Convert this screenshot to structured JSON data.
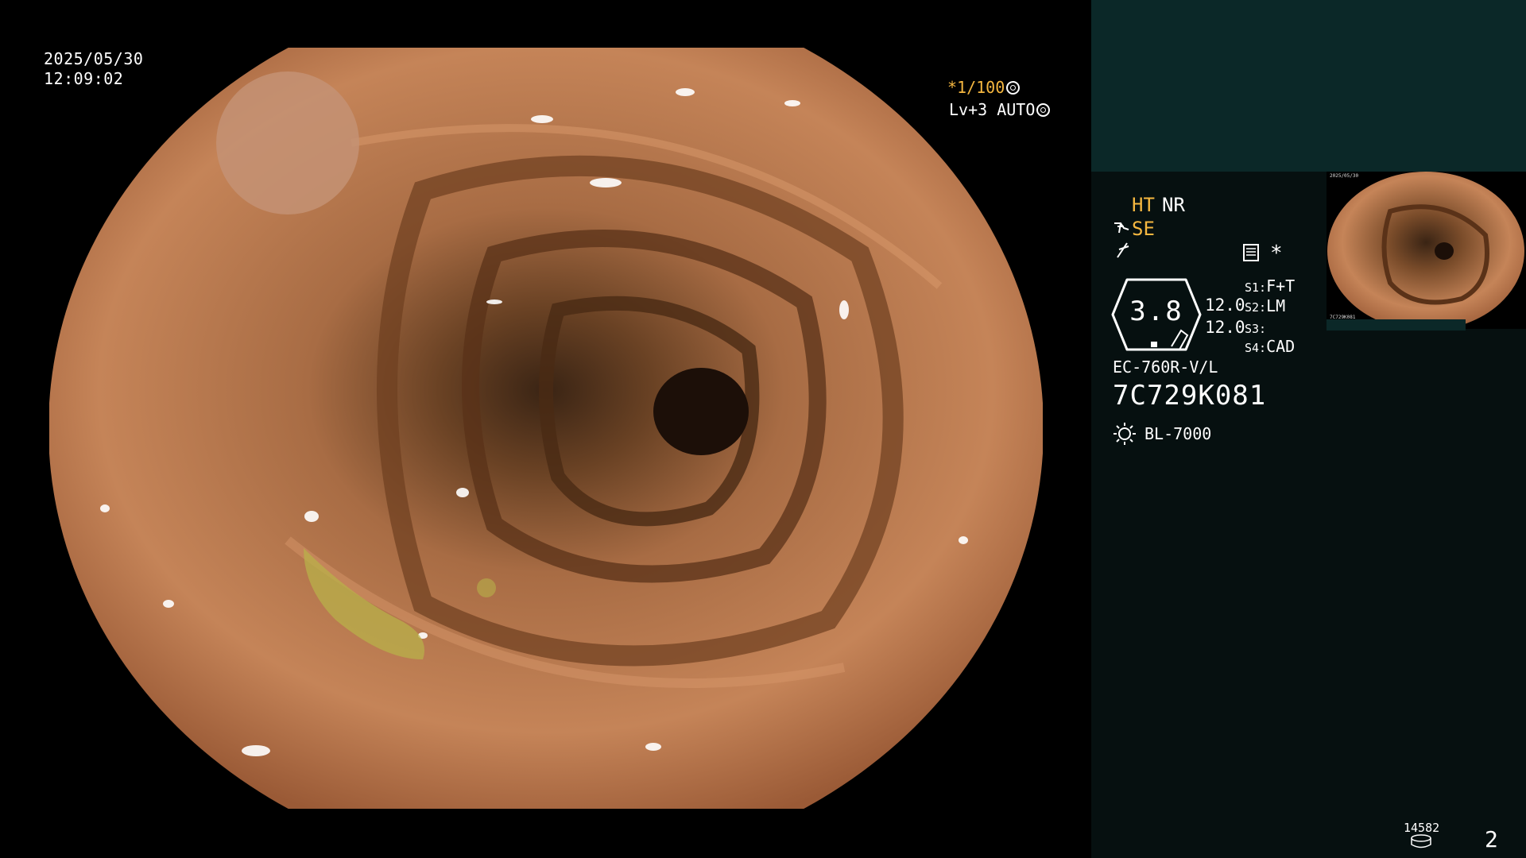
{
  "datetime": {
    "date": "2025/05/30",
    "time": "12:09:02"
  },
  "overlay": {
    "shutter_prefix": "*",
    "shutter": "1/100",
    "level": "Lv+3 AUTO"
  },
  "indicators": {
    "ht": "HT",
    "nr": "NR",
    "se": "SE",
    "star": "*"
  },
  "gauge": {
    "value": "3.8",
    "reading1": "12.0",
    "reading2": "12.0"
  },
  "settings": [
    {
      "key": "S1:",
      "value": "F+T"
    },
    {
      "key": "S2:",
      "value": "LM"
    },
    {
      "key": "S3:",
      "value": ""
    },
    {
      "key": "S4:",
      "value": "CAD"
    }
  ],
  "scope": {
    "model": "EC-760R-V/L",
    "serial": "7C729K081"
  },
  "light_source": "BL-7000",
  "thumbnail": {
    "date": "2025/05/30",
    "serial": "7C729K081"
  },
  "footer": {
    "count": "14582",
    "page": "2"
  },
  "colors": {
    "accent": "#f5b740",
    "panel": "#061010",
    "panel_top": "#0b2828"
  },
  "icons": [
    "shutter-icon",
    "auto-iris-icon",
    "scope-tip-icon",
    "slash-icon",
    "document-icon",
    "light-source-icon",
    "disk-icon"
  ]
}
